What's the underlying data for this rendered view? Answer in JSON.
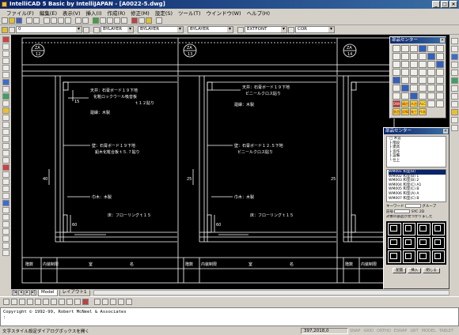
{
  "window": {
    "title": "IntelliCAD 5 Basic by IntelliJAPAN - [A0022-5.dwg]"
  },
  "menu": [
    "ファイル(F)",
    "編集(E)",
    "表示(V)",
    "挿入(I)",
    "作成(R)",
    "修正(M)",
    "設定(S)",
    "ツール(T)",
    "ウインドウ(W)",
    "ヘルプ(H)"
  ],
  "toolbar2": {
    "style_combo": "EXTFONT",
    "dimstyle_combo": "COR"
  },
  "toolbar3": {
    "layer_combo": "0",
    "color_combo": "BYLAYER",
    "linetype_combo": "BYLAYER",
    "lineweight_combo": "BYLAYER"
  },
  "drawing": {
    "markers": [
      "ZA\n12",
      "ZA\n13",
      "ZA\n14"
    ],
    "ceiling_1": [
      "天井：石膏ボード１９下地",
      "化粧ロックウール吸音板",
      "ｔ１２貼り"
    ],
    "ceiling_2": [
      "天井：石膏ボード１９下地",
      "ビニールクロス貼り"
    ],
    "molding": "廻縁：木製",
    "wall_1": [
      "壁：石膏ボード１９下地",
      "鉛木化粧合板ｔ５.７貼り"
    ],
    "wall_2": [
      "壁：石膏ボード１２.５下地",
      "ビニールクロス貼り"
    ],
    "baseboard": "巾木：木製",
    "floor": "床：フローリングｔ１５",
    "dims": {
      "d15": "15",
      "d40": "40",
      "d25": "25",
      "d60": "60"
    },
    "table_headers": [
      "階数",
      "内装制限",
      "室",
      "名"
    ]
  },
  "tabs": {
    "model": "Model",
    "layout": "レイアウト1"
  },
  "command": {
    "line1": "Copyright © 1992-99, Robert McNeel & Associates",
    "line2": ":"
  },
  "status": {
    "left": "文字スタイル設定ダイアログボックスを開く",
    "coords": "397,2018,0",
    "modes": [
      "SNAP",
      "GRID",
      "ORTHO",
      "ESNAP",
      "LWT",
      "MODEL",
      "TABLET"
    ]
  },
  "panel1": {
    "title": "部品センター",
    "buttons": [
      "",
      "",
      "",
      "",
      "",
      "",
      "",
      "",
      "",
      "",
      "",
      "",
      "",
      "",
      "",
      "",
      "",
      "",
      "",
      "",
      "",
      "",
      "",
      "",
      "",
      "",
      "",
      "",
      "",
      "",
      "",
      "",
      "",
      "",
      "",
      "",
      "",
      "",
      "",
      "",
      "",
      "",
      "DWG",
      "構造",
      "木造",
      "ALC",
      "",
      "",
      "鉄造",
      "設備",
      "施工",
      "作画"
    ]
  },
  "panel2": {
    "title": "部品センター",
    "tree": [
      "□ 木造",
      "  ├ 階段",
      "  ├ 建具",
      "  ├ 造作",
      "  ├ 設備",
      "  └ 仕上"
    ],
    "list": [
      "WM001",
      "WM002",
      "WM003",
      "WM004",
      "WM005",
      "WM006",
      "WM007"
    ],
    "list_suffix": [
      " 和室(B) ",
      " 和室(B) 1",
      " 和室(B) 2",
      " 和室(C) A1",
      " 和室(C) B",
      " 和室(A) A",
      " 和室(C) B"
    ],
    "keyword_label": "キーワード",
    "keyword_value": "",
    "group_label": "グループ",
    "kind_label": "記号",
    "filter_label": "SYC",
    "check_label": "2D",
    "preview_caption": "対象の部品が見つかりました",
    "buttons": [
      "配置",
      "挿入",
      "閉じる"
    ]
  }
}
